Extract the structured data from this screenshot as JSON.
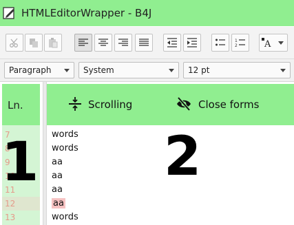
{
  "window": {
    "title": "HTMLEditorWrapper - B4J"
  },
  "toolbar": {
    "buttons": [
      {
        "name": "cut",
        "icon": "scissors-icon",
        "state": "disabled"
      },
      {
        "name": "copy",
        "icon": "copy-icon",
        "state": "disabled"
      },
      {
        "name": "paste",
        "icon": "paste-icon",
        "state": "disabled"
      },
      {
        "name": "align-left",
        "icon": "align-left-icon",
        "state": "active"
      },
      {
        "name": "align-center",
        "icon": "align-center-icon",
        "state": "normal"
      },
      {
        "name": "align-right",
        "icon": "align-right-icon",
        "state": "normal"
      },
      {
        "name": "justify",
        "icon": "justify-icon",
        "state": "normal"
      },
      {
        "name": "outdent",
        "icon": "outdent-icon",
        "state": "normal"
      },
      {
        "name": "indent",
        "icon": "indent-icon",
        "state": "normal"
      },
      {
        "name": "bullets",
        "icon": "bullet-list-icon",
        "state": "normal"
      },
      {
        "name": "numbers",
        "icon": "numbered-list-icon",
        "state": "normal"
      },
      {
        "name": "text-color",
        "icon": "text-color-icon",
        "state": "normal"
      }
    ]
  },
  "format": {
    "paragraph": "Paragraph",
    "font_family": "System",
    "font_size": "12 pt"
  },
  "header": {
    "ln_label": "Ln.",
    "scrolling_label": "Scrolling",
    "close_forms_label": "Close forms"
  },
  "gutter": {
    "line_numbers": [
      "7",
      "8",
      "9",
      "10",
      "11",
      "12",
      "13"
    ],
    "highlighted_line": "12"
  },
  "editor": {
    "lines": [
      "words",
      "words",
      "aa",
      "aa",
      "aa",
      "aa",
      "words"
    ],
    "highlighted_index": 5
  },
  "overlay": {
    "label_one": "1",
    "label_two": "2"
  },
  "colors": {
    "accent_green": "#90ee90",
    "gutter_green": "#d4f5d4",
    "line_number_color": "#e59a8a",
    "highlight_red": "#f6c2c2"
  }
}
